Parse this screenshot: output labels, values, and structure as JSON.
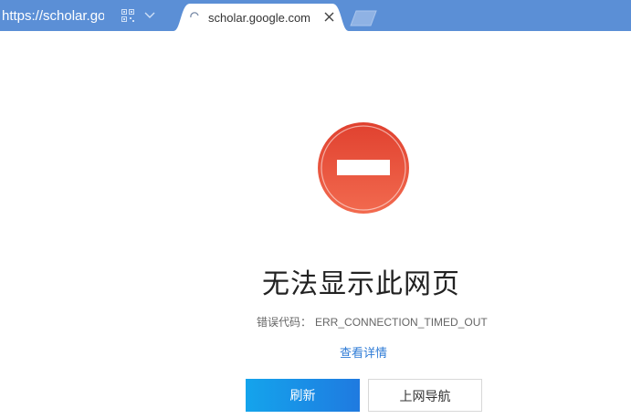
{
  "browser": {
    "address_text": "https://scholar.google.com",
    "tab": {
      "title": "scholar.google.com"
    }
  },
  "error_page": {
    "title": "无法显示此网页",
    "code_label": "错误代码：",
    "code_value": "ERR_CONNECTION_TIMED_OUT",
    "details_link": "查看详情",
    "refresh_button": "刷新",
    "nav_button": "上网导航"
  },
  "colors": {
    "topbar": "#5b8fd6",
    "error_icon": "#e85840",
    "refresh_button": "#1890e8",
    "link": "#2e7bd6"
  },
  "icons": {
    "qr": "qr-code-icon",
    "dropdown": "chevron-down-icon",
    "loading": "loading-spinner-icon",
    "close": "close-icon",
    "new_tab": "new-tab-icon",
    "error": "no-entry-icon"
  }
}
